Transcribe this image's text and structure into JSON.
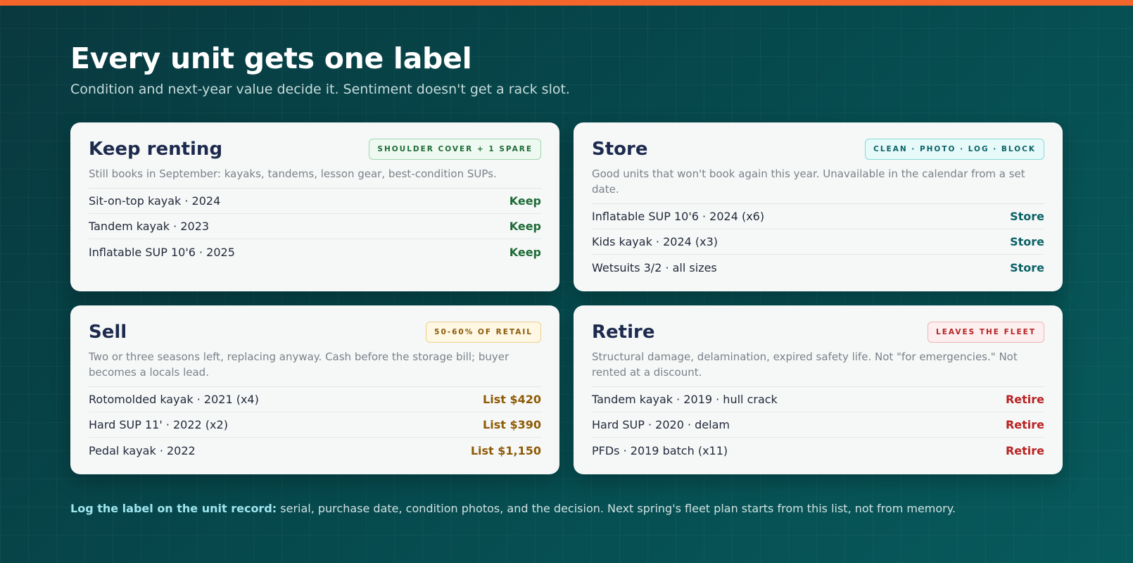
{
  "header": {
    "title": "Every unit gets one label",
    "subtitle": "Condition and next-year value decide it. Sentiment doesn't get a rack slot."
  },
  "cards": [
    {
      "title": "Keep renting",
      "tag": "Shoulder cover + 1 spare",
      "desc": "Still books in September: kayaks, tandems, lesson gear, best-condition SUPs.",
      "rows": [
        {
          "item": "Sit-on-top kayak · 2024",
          "verdict": "Keep"
        },
        {
          "item": "Tandem kayak · 2023",
          "verdict": "Keep"
        },
        {
          "item": "Inflatable SUP 10'6 · 2025",
          "verdict": "Keep"
        }
      ]
    },
    {
      "title": "Store",
      "tag": "Clean · photo · log · block",
      "desc": "Good units that won't book again this year. Unavailable in the calendar from a set date.",
      "rows": [
        {
          "item": "Inflatable SUP 10'6 · 2024 (x6)",
          "verdict": "Store"
        },
        {
          "item": "Kids kayak · 2024 (x3)",
          "verdict": "Store"
        },
        {
          "item": "Wetsuits 3/2 · all sizes",
          "verdict": "Store"
        }
      ]
    },
    {
      "title": "Sell",
      "tag": "50-60% of retail",
      "desc": "Two or three seasons left, replacing anyway. Cash before the storage bill; buyer becomes a locals lead.",
      "rows": [
        {
          "item": "Rotomolded kayak · 2021 (x4)",
          "verdict": "List $420"
        },
        {
          "item": "Hard SUP 11' · 2022 (x2)",
          "verdict": "List $390"
        },
        {
          "item": "Pedal kayak · 2022",
          "verdict": "List $1,150"
        }
      ]
    },
    {
      "title": "Retire",
      "tag": "Leaves the fleet",
      "desc": "Structural damage, delamination, expired safety life. Not \"for emergencies.\" Not rented at a discount.",
      "rows": [
        {
          "item": "Tandem kayak · 2019 · hull crack",
          "verdict": "Retire"
        },
        {
          "item": "Hard SUP · 2020 · delam",
          "verdict": "Retire"
        },
        {
          "item": "PFDs · 2019 batch (x11)",
          "verdict": "Retire"
        }
      ]
    }
  ],
  "footer": {
    "lead": "Log the label on the unit record:",
    "text": " serial, purchase date, condition photos, and the decision. Next spring's fleet plan starts from this list, not from memory."
  },
  "colors": {
    "accent_bar": "#f3652a",
    "keep": "#1e6b36",
    "store": "#0b6266",
    "sell": "#8e5b05",
    "retire": "#b82222"
  }
}
